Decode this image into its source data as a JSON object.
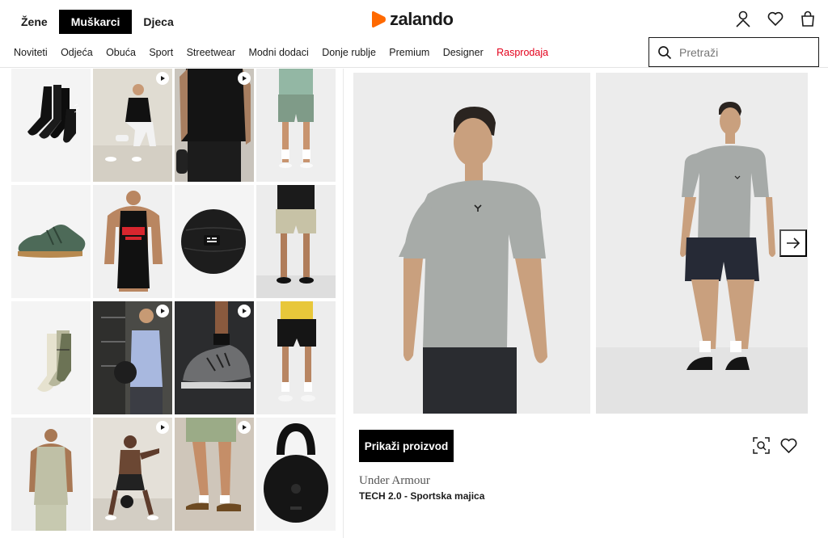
{
  "header": {
    "gender_tabs": [
      {
        "label": "Žene",
        "active": false
      },
      {
        "label": "Muškarci",
        "active": true
      },
      {
        "label": "Djeca",
        "active": false
      }
    ],
    "logo": {
      "text": "zalando",
      "mark_color": "#ff6900"
    },
    "icons": [
      "user-icon",
      "heart-icon",
      "bag-icon"
    ]
  },
  "nav": {
    "items": [
      "Noviteti",
      "Odjeća",
      "Obuća",
      "Sport",
      "Streetwear",
      "Modni dodaci",
      "Donje rublje",
      "Premium",
      "Designer",
      "Rasprodaja"
    ],
    "sale_color": "#e3001b"
  },
  "search": {
    "placeholder": "Pretraži",
    "icon": "search-icon"
  },
  "grid": {
    "tiles": [
      {
        "subject": "black socks",
        "video": false
      },
      {
        "subject": "man in black tee",
        "video": true
      },
      {
        "subject": "black tee close-up",
        "video": true
      },
      {
        "subject": "green shorts",
        "video": false
      },
      {
        "subject": "green training shoe",
        "video": false
      },
      {
        "subject": "tank top model",
        "video": false
      },
      {
        "subject": "slam ball",
        "video": false
      },
      {
        "subject": "beige shorts",
        "video": false
      },
      {
        "subject": "sport socks",
        "video": false
      },
      {
        "subject": "man with medicine ball",
        "video": true
      },
      {
        "subject": "training shoe on floor",
        "video": true
      },
      {
        "subject": "black shorts",
        "video": false
      },
      {
        "subject": "sleeveless top model",
        "video": false
      },
      {
        "subject": "kettlebell workout",
        "video": true
      },
      {
        "subject": "legs with sneakers",
        "video": true
      },
      {
        "subject": "kettlebell",
        "video": false
      }
    ]
  },
  "product": {
    "cta_label": "Prikaži proizvod",
    "brand": "Under Armour",
    "name": "TECH 2.0 - Sportska majica",
    "icons": [
      "visual-search-icon",
      "wishlist-heart-icon",
      "arrow-right-icon"
    ]
  }
}
